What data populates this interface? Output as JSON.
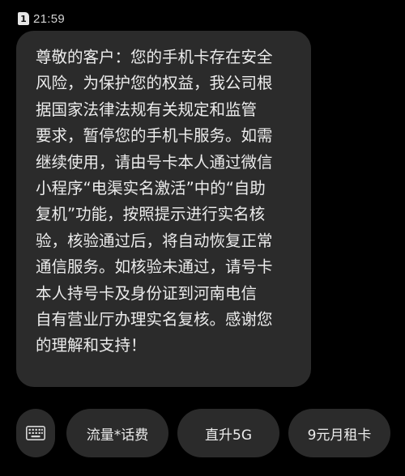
{
  "status_bar": {
    "sim_slot": "1",
    "time": "21:59"
  },
  "message": {
    "text": "尊敬的客户：您的手机卡存在安全\n风险，为保护您的权益，我公司根\n据国家法律法规有关规定和监管\n要求，暂停您的手机卡服务。如需\n继续使用，请由号卡本人通过微信\n小程序“电渠实名激活”中的“自助\n复机”功能，按照提示进行实名核\n验，核验通过后，将自动恢复正常\n通信服务。如核验未通过，请号卡\n本人持号卡及身份证到河南电信\n自有营业厅办理实名复核。感谢您\n的理解和支持！"
  },
  "reply_bar": {
    "keyboard_icon": "keyboard-icon",
    "quick_replies": [
      {
        "label": "流量*话费"
      },
      {
        "label": "直升5G"
      },
      {
        "label": "9元月租卡"
      }
    ]
  },
  "colors": {
    "background": "#000000",
    "bubble": "#2b2b2b",
    "text": "#ececec"
  }
}
